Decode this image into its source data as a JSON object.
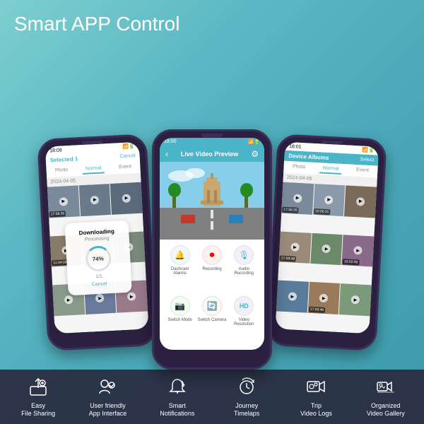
{
  "page": {
    "title_normal": "Smart APP",
    "title_bold": " Control"
  },
  "phones": {
    "left": {
      "selected_text": "Selected 1",
      "cancel_text": "Cancel",
      "tabs": [
        "Photo",
        "Normal",
        "Event"
      ],
      "active_tab": "Normal",
      "date": "2024-04-05",
      "download": {
        "title": "Downloading",
        "subtitle": "Processing",
        "percent": "74%",
        "count": "1/1",
        "cancel": "Cancel"
      }
    },
    "center": {
      "header_title": "Live Video Preview",
      "controls": [
        {
          "label": "Dashcam Alarms",
          "icon": "🔔"
        },
        {
          "label": "Recording",
          "icon": "⏺"
        },
        {
          "label": "Audio Recording",
          "icon": "🎙"
        },
        {
          "label": "Switch Mode",
          "icon": "📷"
        },
        {
          "label": "Switch Camera",
          "icon": "🔄"
        },
        {
          "label": "Video Resolution",
          "icon": "HD"
        }
      ]
    },
    "right": {
      "header_title": "Device Albums",
      "select_label": "Select",
      "tabs": [
        "Photo",
        "Normal",
        "Event"
      ],
      "active_tab": "Normal",
      "date": "2024-04-05"
    }
  },
  "features": [
    {
      "icon": "upload-share-icon",
      "label": "Easy\nFile Sharing"
    },
    {
      "icon": "user-friendly-icon",
      "label": "User friendly\nApp Interface"
    },
    {
      "icon": "bell-refresh-icon",
      "label": "Smart\nNotifications"
    },
    {
      "icon": "clock-journey-icon",
      "label": "Journey\nTimelaps"
    },
    {
      "icon": "video-trip-icon",
      "label": "Trip\nVideo Logs"
    },
    {
      "icon": "gallery-icon",
      "label": "Organized\nVideo Gallery"
    }
  ]
}
